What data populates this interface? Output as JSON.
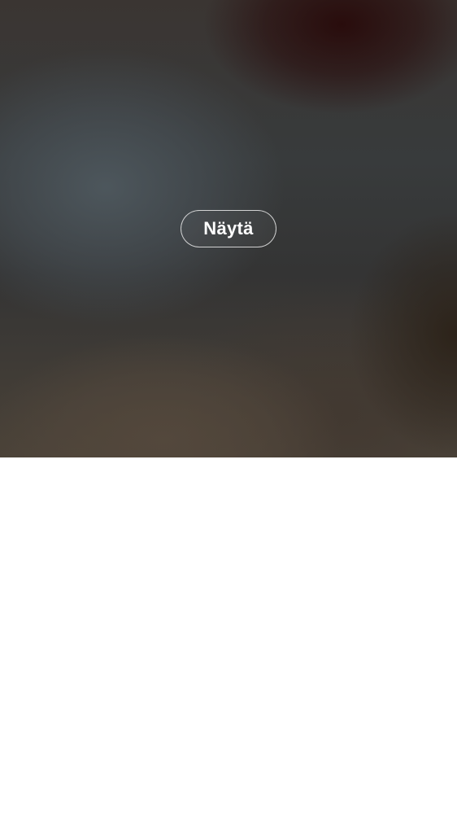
{
  "media": {
    "show_button_label": "Näytä"
  }
}
